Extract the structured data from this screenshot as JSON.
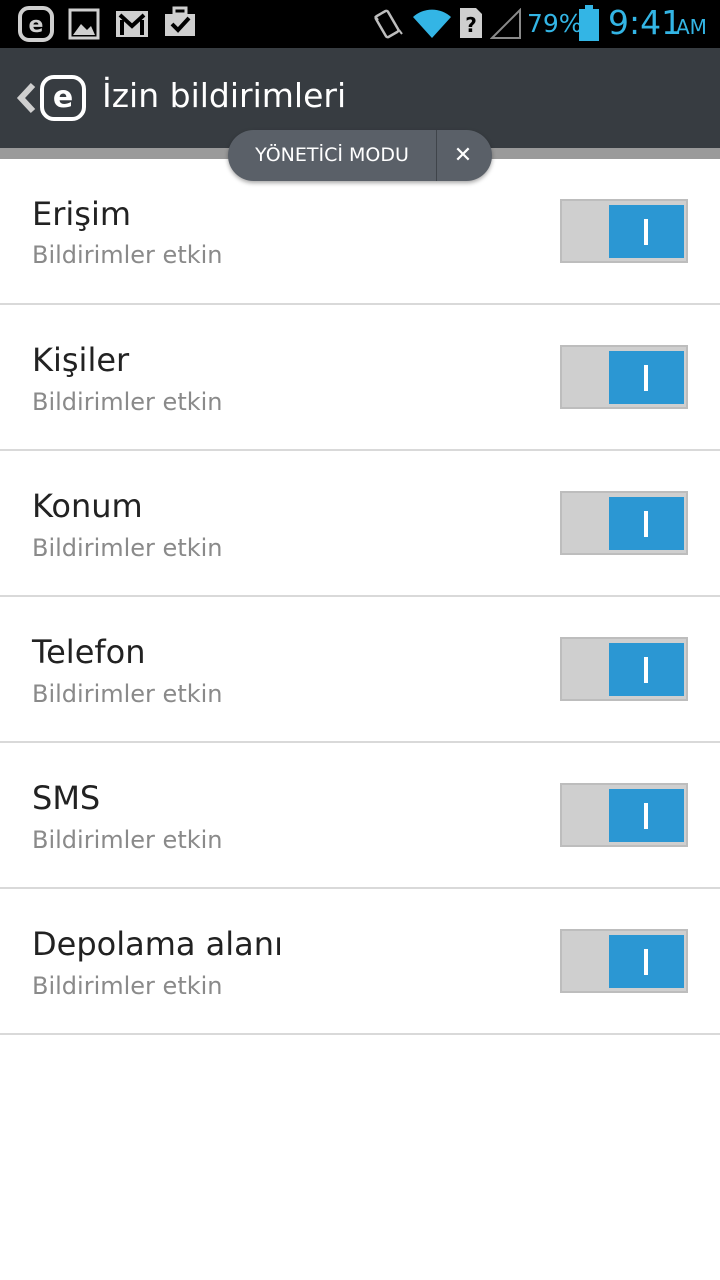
{
  "status_bar": {
    "battery_percent": "79%",
    "time": "9:41",
    "ampm": "AM",
    "icons": [
      "eset-notification-icon",
      "image-icon",
      "gmail-icon",
      "briefcase-check-icon",
      "vibrate-icon",
      "wifi-icon",
      "no-sim-icon",
      "signal-icon",
      "battery-icon"
    ],
    "accent_color": "#33b5e5"
  },
  "header": {
    "title": "İzin bildirimleri",
    "logo_letter": "e",
    "background_color": "#373c41"
  },
  "admin_mode": {
    "label": "YÖNETİCİ MODU",
    "close_glyph": "✕"
  },
  "permissions": [
    {
      "title": "Erişim",
      "subtitle": "Bildirimler etkin",
      "enabled": true
    },
    {
      "title": "Kişiler",
      "subtitle": "Bildirimler etkin",
      "enabled": true
    },
    {
      "title": "Konum",
      "subtitle": "Bildirimler etkin",
      "enabled": true
    },
    {
      "title": "Telefon",
      "subtitle": "Bildirimler etkin",
      "enabled": true
    },
    {
      "title": "SMS",
      "subtitle": "Bildirimler etkin",
      "enabled": true
    },
    {
      "title": "Depolama alanı",
      "subtitle": "Bildirimler etkin",
      "enabled": true
    }
  ],
  "toggle_color": "#2b97d3"
}
